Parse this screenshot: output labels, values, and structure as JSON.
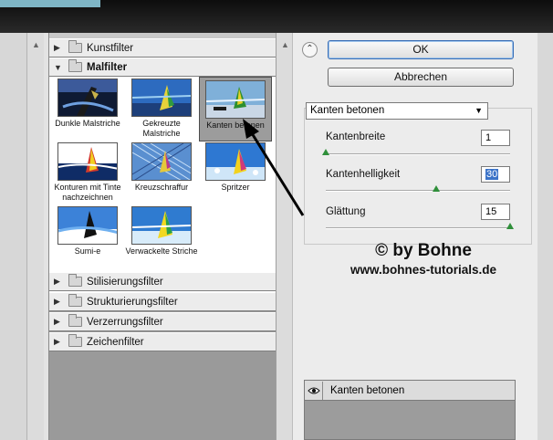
{
  "categories": {
    "kunstfilter": "Kunstfilter",
    "malfilter": "Malfilter",
    "stilisierungsfilter": "Stilisierungsfilter",
    "strukturierungsfilter": "Strukturierungsfilter",
    "verzerrungsfilter": "Verzerrungsfilter",
    "zeichenfilter": "Zeichenfilter"
  },
  "thumbnails": [
    {
      "label": "Dunkle Malstriche"
    },
    {
      "label": "Gekreuzte Malstriche"
    },
    {
      "label": "Kanten betonen",
      "selected": true
    },
    {
      "label": "Konturen mit Tinte nachzeichnen"
    },
    {
      "label": "Kreuzschraffur"
    },
    {
      "label": "Spritzer"
    },
    {
      "label": "Sumi-e"
    },
    {
      "label": "Verwackelte Striche"
    }
  ],
  "buttons": {
    "ok": "OK",
    "cancel": "Abbrechen"
  },
  "filter_select": {
    "value": "Kanten betonen"
  },
  "params": [
    {
      "label": "Kantenbreite",
      "value": "1",
      "level": 0.0
    },
    {
      "label": "Kantenhelligkeit",
      "value": "30",
      "level": 0.6
    },
    {
      "label": "Glättung",
      "value": "15",
      "level": 1.0
    }
  ],
  "watermark": {
    "line1": "© by Bohne",
    "line2": "www.bohnes-tutorials.de"
  },
  "layer": {
    "name": "Kanten betonen"
  },
  "colors": {
    "selection_highlight": "#3b73c8",
    "slider_knob": "#2f8f3a"
  }
}
